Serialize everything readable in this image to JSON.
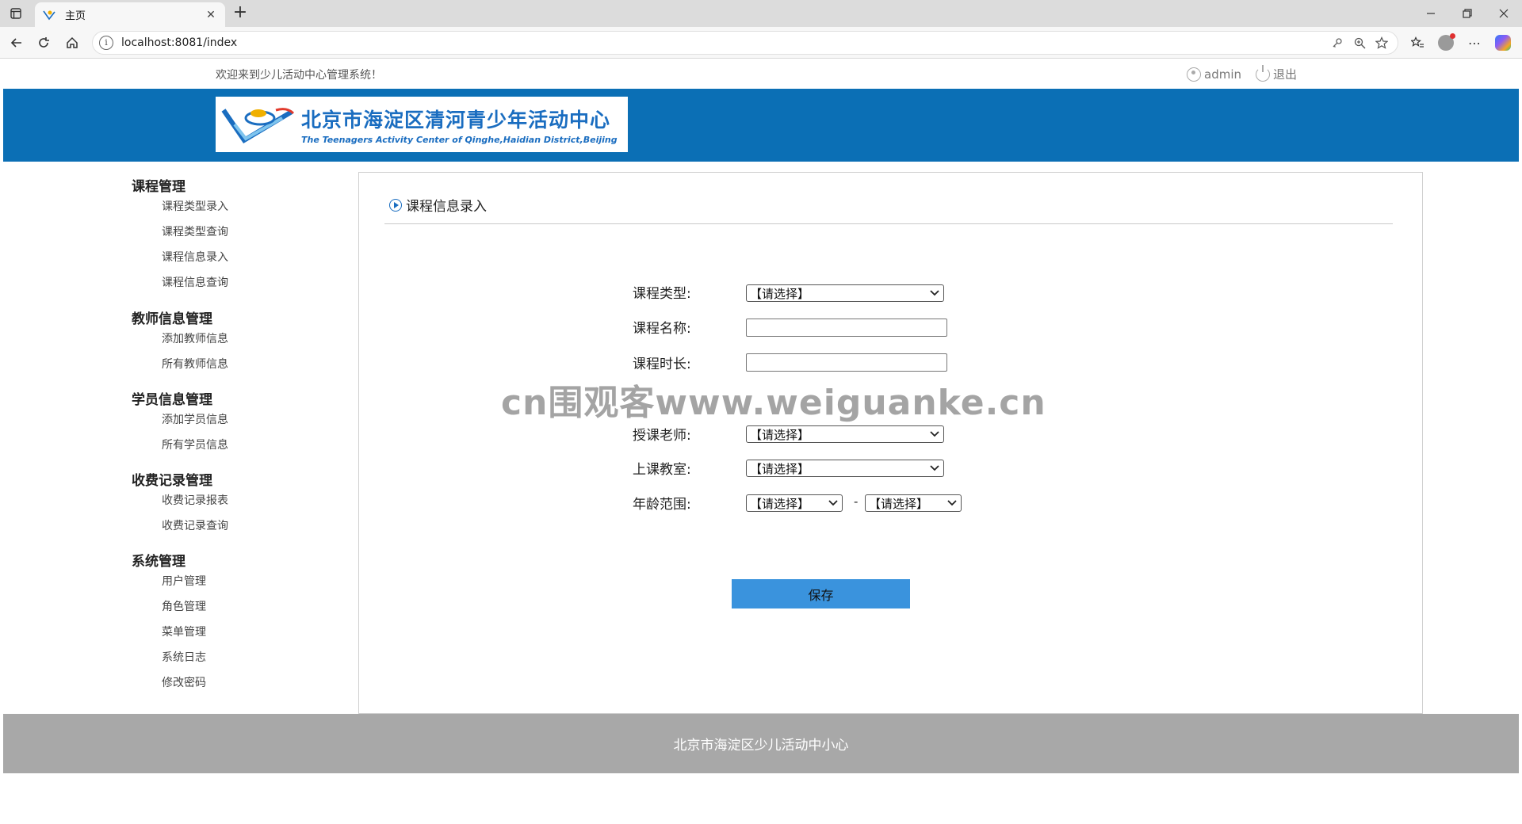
{
  "browser": {
    "tab_title": "主页",
    "new_tab": "+",
    "url": "localhost:8081/index"
  },
  "header": {
    "welcome": "欢迎来到少儿活动中心管理系统！",
    "username": "admin",
    "logout": "退出"
  },
  "logo": {
    "cn": "北京市海淀区清河青少年活动中心",
    "en": "The Teenagers Activity Center of Qinghe,Haidian District,Beijing"
  },
  "sidebar": {
    "groups": [
      {
        "title": "课程管理",
        "items": [
          "课程类型录入",
          "课程类型查询",
          "课程信息录入",
          "课程信息查询"
        ]
      },
      {
        "title": "教师信息管理",
        "items": [
          "添加教师信息",
          "所有教师信息"
        ]
      },
      {
        "title": "学员信息管理",
        "items": [
          "添加学员信息",
          "所有学员信息"
        ]
      },
      {
        "title": "收费记录管理",
        "items": [
          "收费记录报表",
          "收费记录查询"
        ]
      },
      {
        "title": "系统管理",
        "items": [
          "用户管理",
          "角色管理",
          "菜单管理",
          "系统日志",
          "修改密码"
        ]
      }
    ]
  },
  "main": {
    "title": "课程信息录入",
    "form": {
      "course_type_label": "课程类型:",
      "course_type_value": "【请选择】",
      "course_name_label": "课程名称:",
      "course_name_value": "",
      "course_duration_label": "课程时长:",
      "course_duration_value": "",
      "teacher_label": "授课老师:",
      "teacher_value": "【请选择】",
      "classroom_label": "上课教室:",
      "classroom_value": "【请选择】",
      "age_range_label": "年龄范围:",
      "age_min_value": "【请选择】",
      "age_separator": "-",
      "age_max_value": "【请选择】",
      "save_label": "保存"
    }
  },
  "watermark": "cn围观客www.weiguanke.cn",
  "footer": {
    "text": "北京市海淀区少儿活动中小心"
  }
}
